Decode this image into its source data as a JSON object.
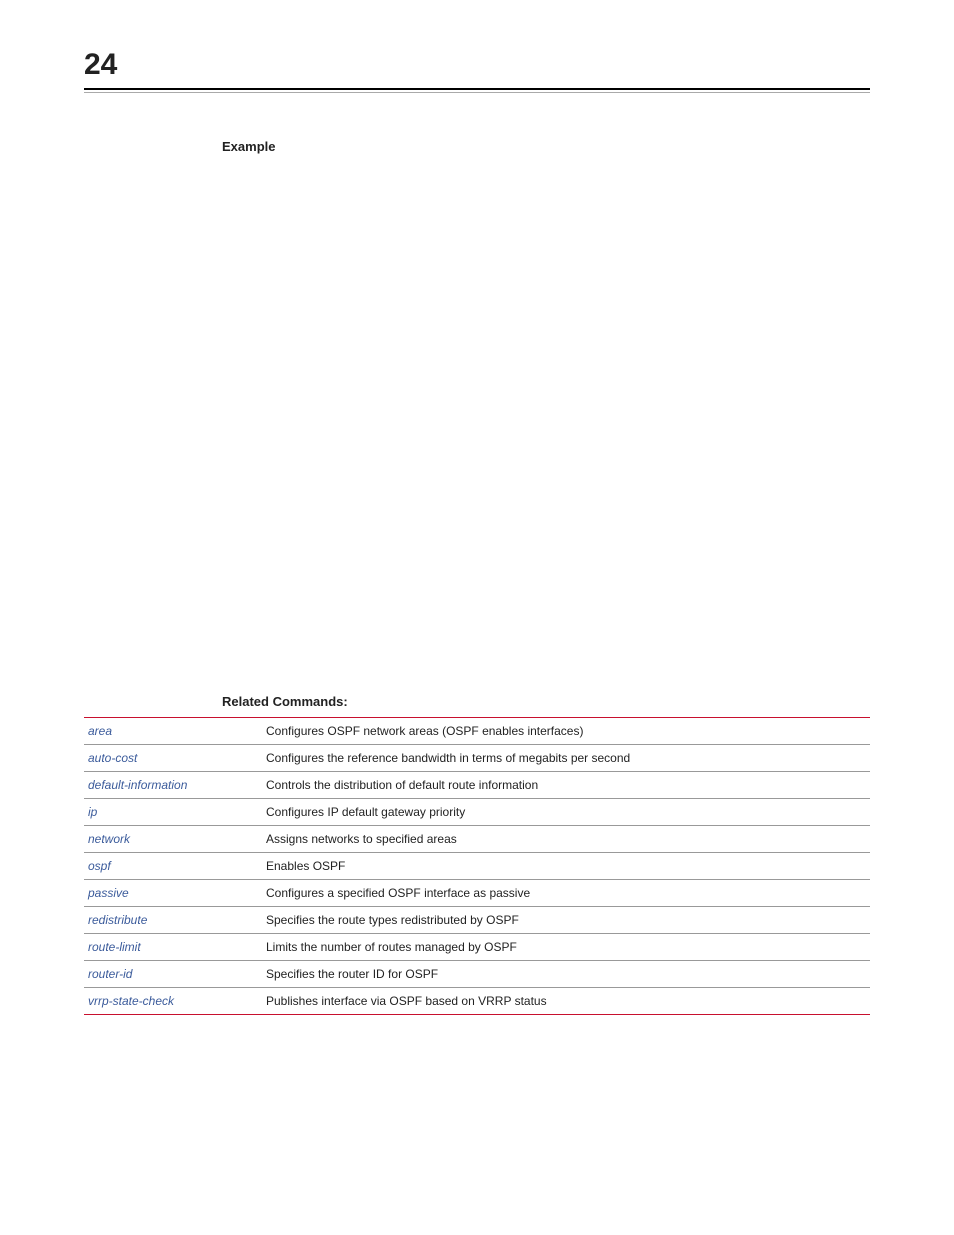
{
  "chapter_number": "24",
  "example_label": "Example",
  "related_label": "Related Commands:",
  "related": [
    {
      "cmd": "area",
      "desc": "Configures OSPF network areas (OSPF enables interfaces)"
    },
    {
      "cmd": "auto-cost",
      "desc": "Configures the reference bandwidth in terms of megabits per second"
    },
    {
      "cmd": "default-information",
      "desc": "Controls the distribution of default route information"
    },
    {
      "cmd": "ip",
      "desc": "Configures IP default gateway priority"
    },
    {
      "cmd": "network",
      "desc": "Assigns networks to specified areas"
    },
    {
      "cmd": "ospf",
      "desc": "Enables OSPF"
    },
    {
      "cmd": "passive",
      "desc": "Configures a specified OSPF interface as passive"
    },
    {
      "cmd": "redistribute",
      "desc": "Specifies the route types redistributed by OSPF"
    },
    {
      "cmd": "route-limit",
      "desc": "Limits the number of routes managed by OSPF"
    },
    {
      "cmd": "router-id",
      "desc": "Specifies the router ID for OSPF"
    },
    {
      "cmd": "vrrp-state-check",
      "desc": "Publishes interface via OSPF based on VRRP status"
    }
  ]
}
